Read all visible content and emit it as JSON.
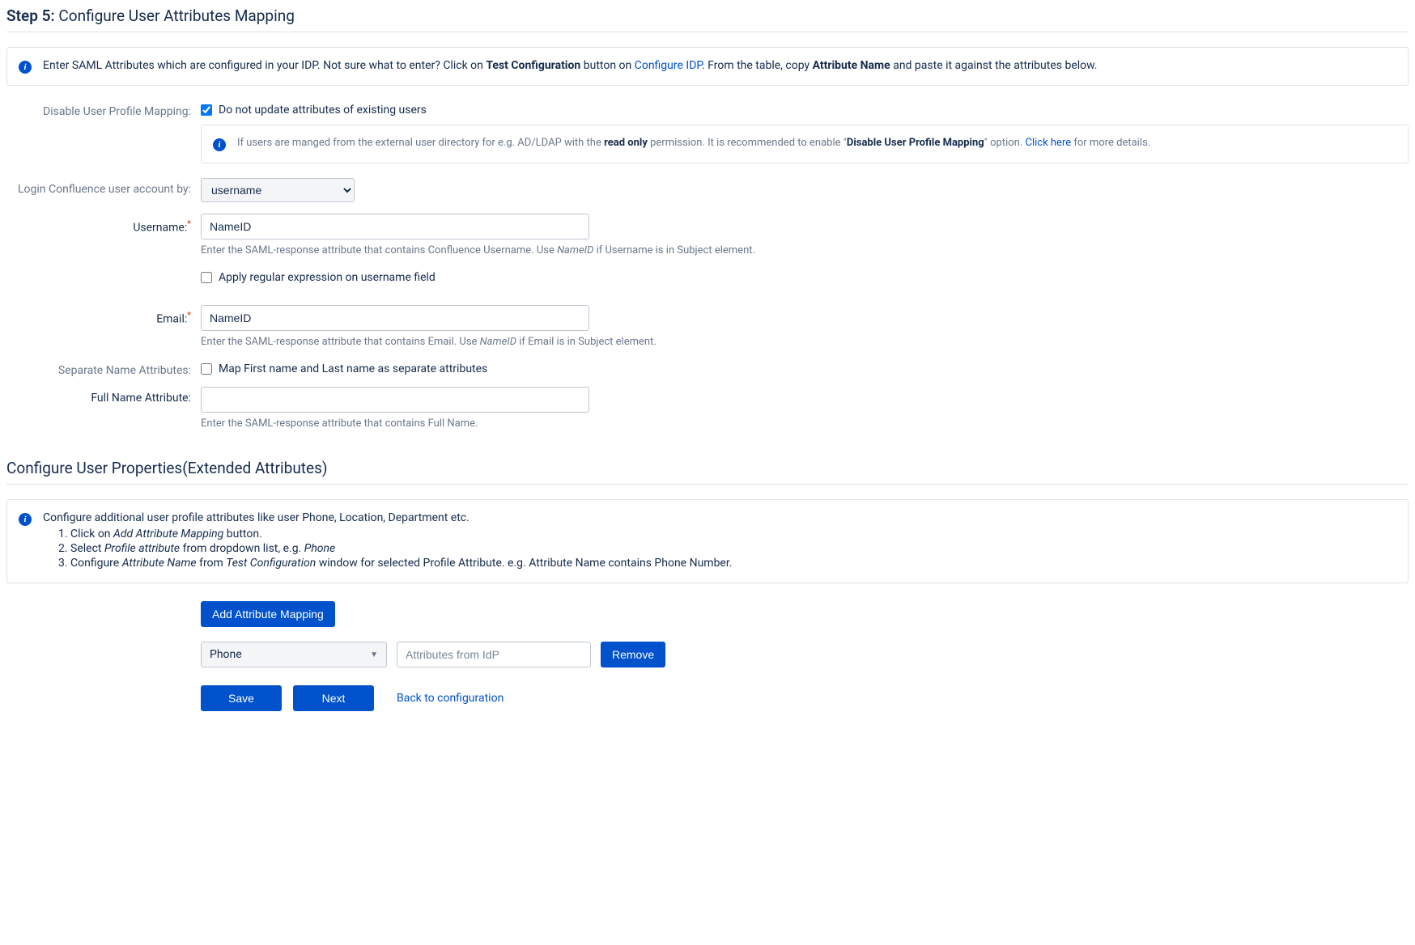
{
  "step": {
    "prefix": "Step 5:",
    "title": "Configure User Attributes Mapping"
  },
  "attr_info": {
    "part1": "Enter SAML Attributes which are configured in your IDP. Not sure what to enter? Click on ",
    "bold1": "Test Configuration",
    "part2": " button on ",
    "link1": "Configure IDP",
    "part3": ". From the table, copy ",
    "bold2": "Attribute Name",
    "part4": " and paste it against the attributes below."
  },
  "disable_mapping": {
    "label": "Disable User Profile Mapping:",
    "checkbox_label": "Do not update attributes of existing users",
    "checked": true,
    "info_part1": "If users are manged from the external user directory for e.g. AD/LDAP with the ",
    "info_bold1": "read only",
    "info_part2": " permission. It is recommended to enable \"",
    "info_bold2": "Disable User Profile Mapping",
    "info_part3": "\" option. ",
    "info_link": "Click here",
    "info_part4": " for more details."
  },
  "login_by": {
    "label": "Login Confluence user account by:",
    "value": "username"
  },
  "username": {
    "label": "Username:",
    "value": "NameID",
    "help_part1": "Enter the SAML-response attribute that contains Confluence Username. Use ",
    "help_em": "NameID",
    "help_part2": " if Username is in Subject element."
  },
  "regex": {
    "label": "Apply regular expression on username field",
    "checked": false
  },
  "email": {
    "label": "Email:",
    "value": "NameID",
    "help_part1": "Enter the SAML-response attribute that contains Email. Use ",
    "help_em": "NameID",
    "help_part2": " if Email is in Subject element."
  },
  "separate_name": {
    "label": "Separate Name Attributes:",
    "checkbox_label": "Map First name and Last name as separate attributes",
    "checked": false
  },
  "full_name": {
    "label": "Full Name Attribute:",
    "value": "",
    "help": "Enter the SAML-response attribute that contains Full Name."
  },
  "extended": {
    "title": "Configure User Properties(Extended Attributes)",
    "intro": "Configure additional user profile attributes like user Phone, Location, Department etc.",
    "li1_a": "Click on ",
    "li1_em": "Add Attribute Mapping",
    "li1_b": " button.",
    "li2_a": "Select ",
    "li2_em": "Profile attribute",
    "li2_b": " from dropdown list, e.g. ",
    "li2_em2": "Phone",
    "li3_a": "Configure ",
    "li3_em": "Attribute Name",
    "li3_b": " from ",
    "li3_em2": "Test Configuration",
    "li3_c": " window for selected Profile Attribute. e.g. Attribute Name contains Phone Number."
  },
  "add_mapping_btn": "Add Attribute Mapping",
  "mapping_row": {
    "select_value": "Phone",
    "input_placeholder": "Attributes from IdP",
    "remove_btn": "Remove"
  },
  "buttons": {
    "save": "Save",
    "next": "Next",
    "back": "Back to configuration"
  }
}
